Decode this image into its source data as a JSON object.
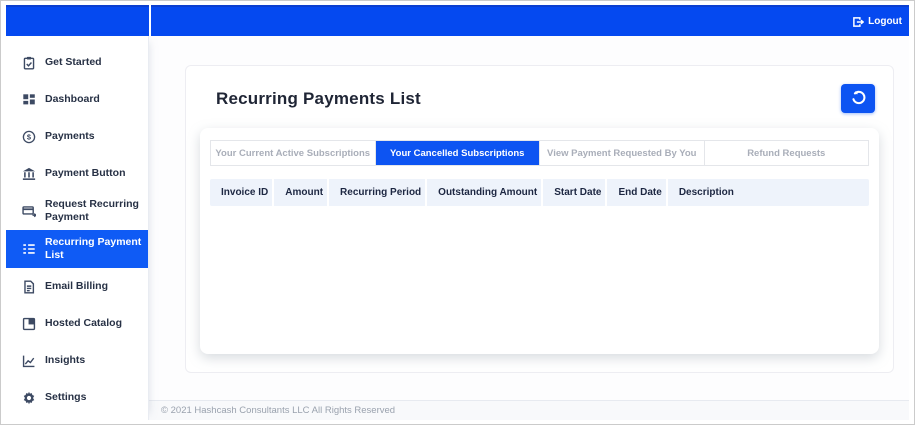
{
  "topbar": {
    "logout_label": "Logout",
    "logout_icon": "logout"
  },
  "sidebar": {
    "items": [
      {
        "label": "Get Started",
        "icon": "clipboard-check",
        "active": false
      },
      {
        "label": "Dashboard",
        "icon": "grid",
        "active": false
      },
      {
        "label": "Payments",
        "icon": "dollar-circle",
        "active": false
      },
      {
        "label": "Payment Button",
        "icon": "bank",
        "active": false
      },
      {
        "label": "Request Recurring Payment",
        "icon": "card-request",
        "active": false
      },
      {
        "label": "Recurring Payment List",
        "icon": "list",
        "active": true
      },
      {
        "label": "Email Billing",
        "icon": "file-text",
        "active": false
      },
      {
        "label": "Hosted Catalog",
        "icon": "image",
        "active": false
      },
      {
        "label": "Insights",
        "icon": "chart",
        "active": false
      },
      {
        "label": "Settings",
        "icon": "gear",
        "active": false
      }
    ]
  },
  "main": {
    "title": "Recurring Payments List",
    "refresh_button_icon": "history",
    "tabs": [
      {
        "label": "Your Current Active Subscriptions",
        "active": false
      },
      {
        "label": "Your Cancelled Subscriptions",
        "active": true
      },
      {
        "label": "View Payment Requested By You",
        "active": false
      },
      {
        "label": "Refund Requests",
        "active": false
      }
    ],
    "table": {
      "columns": [
        "Invoice ID",
        "Amount",
        "Recurring Period",
        "Outstanding Amount",
        "Start Date",
        "End Date",
        "Description"
      ],
      "rows": []
    }
  },
  "footer": {
    "copyright": "© 2021 Hashcash Consultants LLC All Rights Reserved"
  },
  "colors": {
    "primary_blue": "#0d54f2",
    "topbar_blue": "#0549f0",
    "active_sidebar_blue": "#0f5bf5",
    "table_header_bg": "#eef3fb",
    "table_header_text": "#1d2742",
    "inactive_tab_text": "#a9aeb9",
    "footer_bg": "#f8f9fb"
  }
}
